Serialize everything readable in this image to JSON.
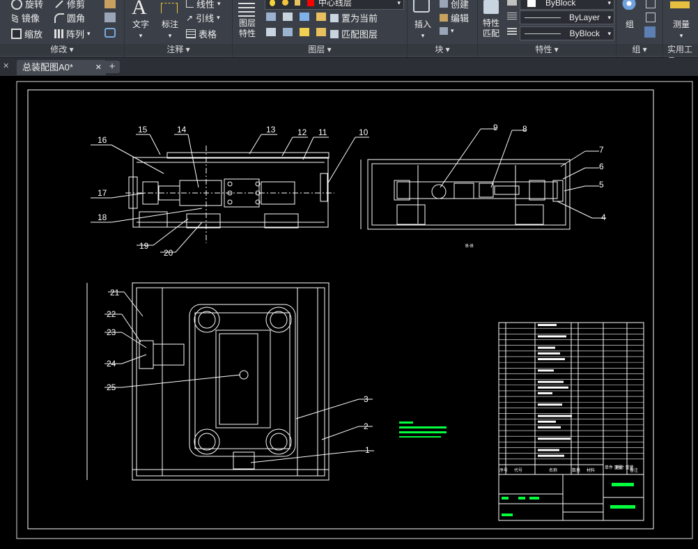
{
  "ribbon": {
    "modify": {
      "title": "修改",
      "items": [
        "旋转",
        "修剪",
        "镜像",
        "圆角",
        "缩放",
        "阵列"
      ]
    },
    "annotation": {
      "title": "注释",
      "text_label": "文字",
      "dim_label": "标注",
      "items": [
        "线性",
        "引线",
        "表格"
      ]
    },
    "layers": {
      "title": "图层",
      "props_label": "图层\n特性",
      "current_layer": "中心线层",
      "items": [
        "置为当前",
        "匹配图层"
      ]
    },
    "block": {
      "title": "块",
      "insert_label": "插入",
      "items": [
        "创建",
        "编辑"
      ]
    },
    "properties": {
      "title": "特性",
      "match_label": "特性\n匹配",
      "color": "ByBlock",
      "linetype": "ByLayer",
      "lineweight": "ByBlock"
    },
    "groups": {
      "title": "组",
      "group_label": "组"
    },
    "utilities": {
      "title": "实用工具",
      "measure_label": "测量"
    }
  },
  "tabs": {
    "close_glyph": "✕",
    "file_tab": "总装配图A0*",
    "new_tab_glyph": "+"
  },
  "drawing": {
    "balloons_top_left": [
      "16",
      "15",
      "14",
      "13",
      "12",
      "11",
      "10",
      "17",
      "18",
      "19",
      "20"
    ],
    "balloons_top_right": [
      "9",
      "8",
      "7",
      "6",
      "5",
      "4"
    ],
    "balloons_bottom": [
      "21",
      "22",
      "23",
      "24",
      "25",
      "3",
      "2",
      "1"
    ],
    "section_label": "B-B",
    "title_block": {
      "header_cells": [
        "序号",
        "代号",
        "名称",
        "数量",
        "材料",
        "单件 重量",
        "总计 重量",
        "备注"
      ]
    }
  },
  "colors": {
    "ribbon_bg": "#3b4048",
    "canvas_bg": "#000000",
    "lines": "#ffffff",
    "tech_notes": "#00ff3c"
  }
}
